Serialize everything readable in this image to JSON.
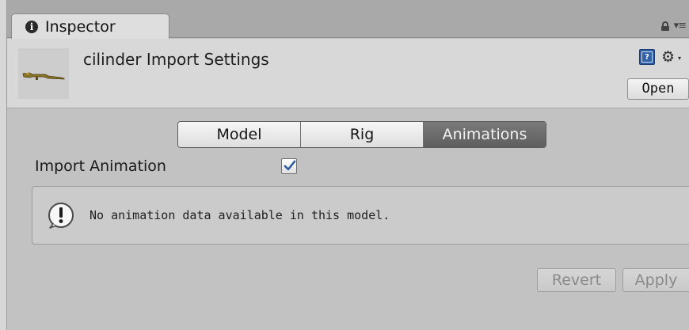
{
  "tab": {
    "label": "Inspector",
    "icon": "info-icon"
  },
  "header": {
    "title": "cilinder Import Settings",
    "open_label": "Open",
    "help_glyph": "?"
  },
  "toolbar": {
    "tabs": [
      {
        "label": "Model",
        "active": false
      },
      {
        "label": "Rig",
        "active": false
      },
      {
        "label": "Animations",
        "active": true
      }
    ]
  },
  "import_animation": {
    "label": "Import Animation",
    "checked": true
  },
  "helpbox": {
    "message": "No animation data available in this model."
  },
  "footer": {
    "revert_label": "Revert",
    "apply_label": "Apply"
  },
  "colors": {
    "active_tab": "#6a6a6a",
    "checkbox_tick": "#2c5c9c",
    "help_icon": "#2f5fa8"
  }
}
